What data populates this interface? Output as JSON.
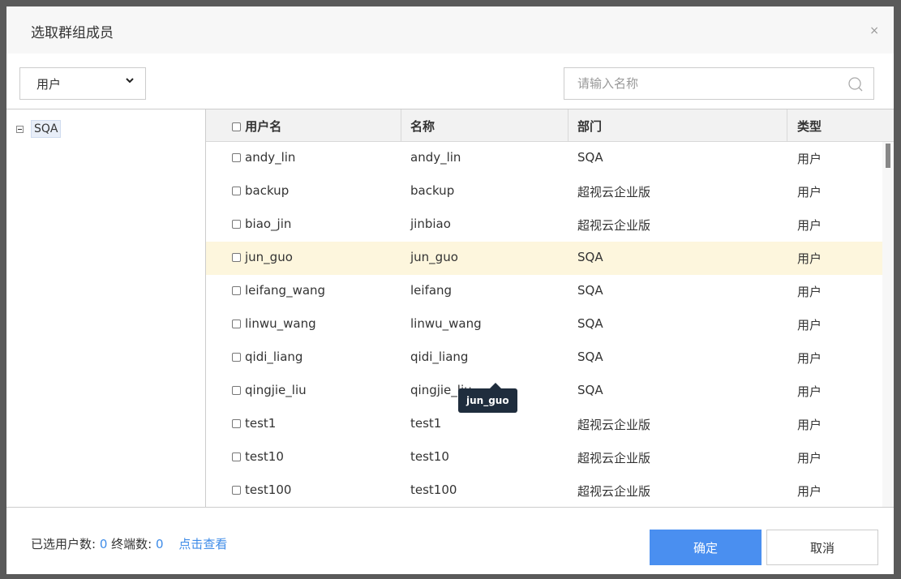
{
  "dialog": {
    "title": "选取群组成员",
    "close_glyph": "×"
  },
  "toolbar": {
    "type_select": {
      "value": "用户",
      "icon": "chevron-down-icon"
    },
    "search": {
      "placeholder": "请输入名称",
      "value": "",
      "icon": "search-icon"
    }
  },
  "tree": {
    "root": {
      "label": "SQA",
      "icon": "collapse-icon"
    }
  },
  "table": {
    "headers": [
      "用户名",
      "名称",
      "部门",
      "类型"
    ],
    "rows": [
      {
        "username": "andy_lin",
        "name": "andy_lin",
        "dept": "SQA",
        "type": "用户"
      },
      {
        "username": "backup",
        "name": "backup",
        "dept": "超视云企业版",
        "type": "用户"
      },
      {
        "username": "biao_jin",
        "name": "jinbiao",
        "dept": "超视云企业版",
        "type": "用户"
      },
      {
        "username": "jun_guo",
        "name": "jun_guo",
        "dept": "SQA",
        "type": "用户"
      },
      {
        "username": "leifang_wang",
        "name": "leifang",
        "dept": "SQA",
        "type": "用户"
      },
      {
        "username": "linwu_wang",
        "name": "linwu_wang",
        "dept": "SQA",
        "type": "用户"
      },
      {
        "username": "qidi_liang",
        "name": "qidi_liang",
        "dept": "SQA",
        "type": "用户"
      },
      {
        "username": "qingjie_liu",
        "name": "qingjie_liu",
        "dept": "SQA",
        "type": "用户"
      },
      {
        "username": "test1",
        "name": "test1",
        "dept": "超视云企业版",
        "type": "用户"
      },
      {
        "username": "test10",
        "name": "test10",
        "dept": "超视云企业版",
        "type": "用户"
      },
      {
        "username": "test100",
        "name": "test100",
        "dept": "超视云企业版",
        "type": "用户"
      }
    ],
    "highlighted_row_username": "jun_guo",
    "tooltip": "jun_guo"
  },
  "footer": {
    "selected_users_label": "已选用户数:",
    "selected_users_count": "0",
    "terminals_label": "终端数:",
    "terminals_count": "0",
    "view_link": "点击查看",
    "ok_label": "确定",
    "cancel_label": "取消"
  },
  "colors": {
    "accent": "#4a8ff0",
    "link": "#3f8ce8",
    "row_highlight": "#fdf6dd",
    "tooltip_bg": "#1f2d3d"
  }
}
